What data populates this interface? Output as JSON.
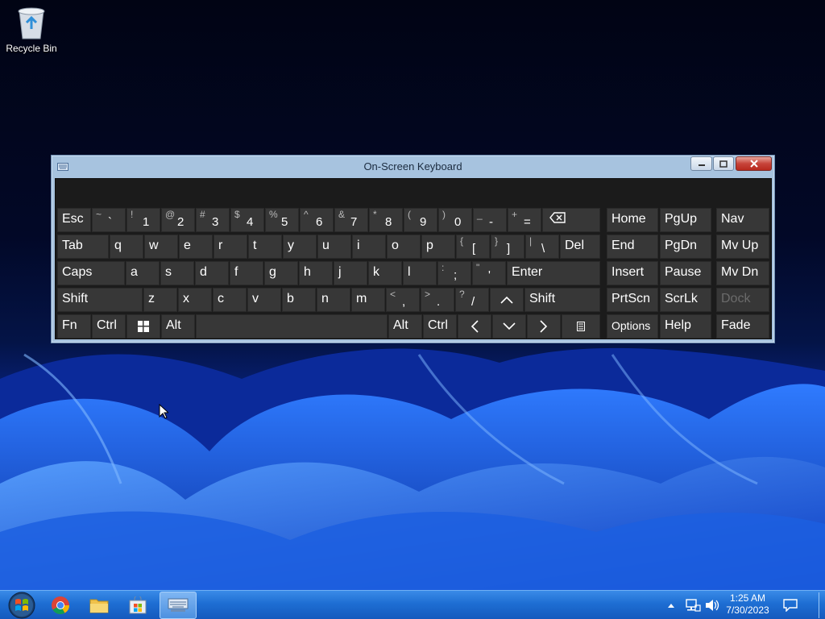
{
  "desktop": {
    "icons": [
      {
        "label": "Recycle Bin",
        "icon": "recycle-bin-icon"
      }
    ]
  },
  "osk": {
    "title": "On-Screen Keyboard",
    "icon": "keyboard-icon",
    "controls": {
      "minimize": "minimize-icon",
      "maximize": "maximize-icon",
      "close": "close-icon"
    },
    "keys": {
      "esc": "Esc",
      "grave": {
        "shift": "~",
        "main": "`"
      },
      "d1": {
        "shift": "!",
        "main": "1"
      },
      "d2": {
        "shift": "@",
        "main": "2"
      },
      "d3": {
        "shift": "#",
        "main": "3"
      },
      "d4": {
        "shift": "$",
        "main": "4"
      },
      "d5": {
        "shift": "%",
        "main": "5"
      },
      "d6": {
        "shift": "^",
        "main": "6"
      },
      "d7": {
        "shift": "&",
        "main": "7"
      },
      "d8": {
        "shift": "*",
        "main": "8"
      },
      "d9": {
        "shift": "(",
        "main": "9"
      },
      "d0": {
        "shift": ")",
        "main": "0"
      },
      "minus": {
        "shift": "_",
        "main": "-"
      },
      "equals": {
        "shift": "+",
        "main": "="
      },
      "backspace": "backspace-icon",
      "tab": "Tab",
      "q": "q",
      "w": "w",
      "e": "e",
      "r": "r",
      "t": "t",
      "y": "y",
      "u": "u",
      "i": "i",
      "o": "o",
      "p": "p",
      "lbracket": {
        "shift": "{",
        "main": "["
      },
      "rbracket": {
        "shift": "}",
        "main": "]"
      },
      "backslash": {
        "shift": "|",
        "main": "\\"
      },
      "del": "Del",
      "caps": "Caps",
      "a": "a",
      "s": "s",
      "d": "d",
      "f": "f",
      "g": "g",
      "h": "h",
      "j": "j",
      "k": "k",
      "l": "l",
      "semicolon": {
        "shift": ":",
        "main": ";"
      },
      "quote": {
        "shift": "\"",
        "main": "'"
      },
      "enter": "Enter",
      "lshift": "Shift",
      "z": "z",
      "x": "x",
      "c": "c",
      "v": "v",
      "b": "b",
      "n": "n",
      "m": "m",
      "comma": {
        "shift": "<",
        "main": ","
      },
      "period": {
        "shift": ">",
        "main": "."
      },
      "slash": {
        "shift": "?",
        "main": "/"
      },
      "up": "^",
      "rshift": "Shift",
      "fn": "Fn",
      "lctrl": "Ctrl",
      "win": "windows-icon",
      "lalt": "Alt",
      "ralt": "Alt",
      "rctrl": "Ctrl",
      "left": "<",
      "down": "v",
      "right": ">",
      "menu": "context-menu-icon",
      "home": "Home",
      "pgup": "PgUp",
      "nav": "Nav",
      "end": "End",
      "pgdn": "PgDn",
      "mvup": "Mv Up",
      "insert": "Insert",
      "pause": "Pause",
      "mvdn": "Mv Dn",
      "prtscn": "PrtScn",
      "scrlk": "ScrLk",
      "dock": "Dock",
      "options": "Options",
      "help": "Help",
      "fade": "Fade"
    }
  },
  "taskbar": {
    "start": "start-orb-icon",
    "pinned": [
      {
        "name": "chrome-icon"
      },
      {
        "name": "file-explorer-icon"
      },
      {
        "name": "store-icon"
      },
      {
        "name": "on-screen-keyboard-taskbar-icon",
        "active": true
      }
    ],
    "tray": {
      "show_hidden": "up-arrow-icon",
      "network": "network-icon",
      "volume": "volume-icon",
      "time": "1:25 AM",
      "date": "7/30/2023",
      "notifications": "notification-icon"
    }
  }
}
